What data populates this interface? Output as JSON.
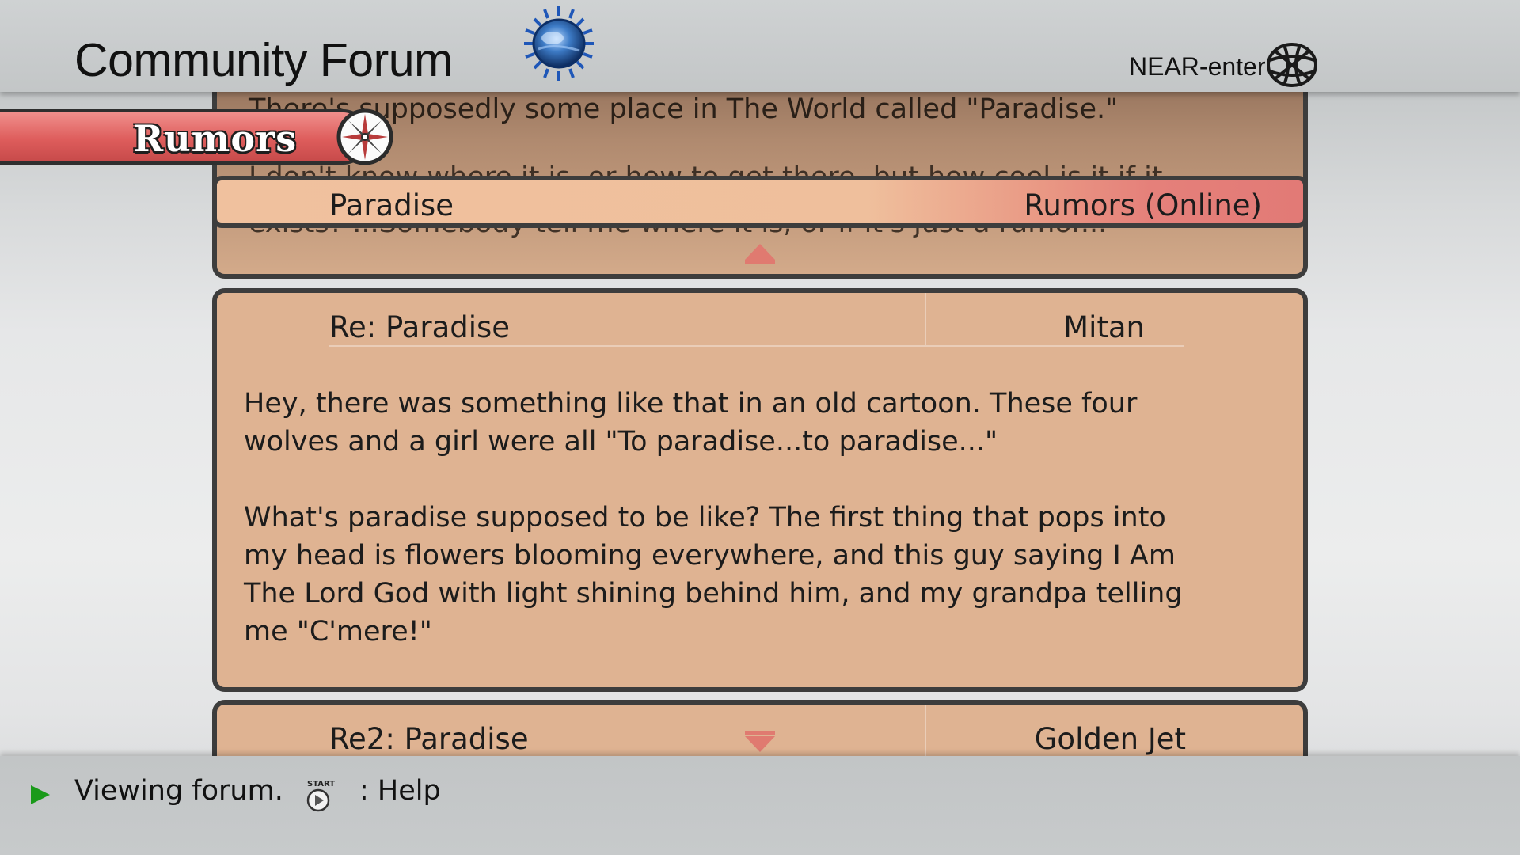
{
  "header": {
    "title": "Community Forum",
    "mode_label": "NEAR-enter",
    "emblem_icon": "world-globe-emblem",
    "network_icon": "globe-wireframe-icon"
  },
  "category": {
    "label": "Rumors",
    "icon": "compass-icon",
    "color": "#de5d5c"
  },
  "previous_post": {
    "line1": "There's supposedly some place in The World called \"Paradise.\"",
    "line2": "I don't know where it is, or how to get there, but how cool is it if it",
    "line3": "exists? ...Somebody tell me where it is, or if it's just a rumor..."
  },
  "topic": {
    "title": "Paradise",
    "board": "Rumors (Online)"
  },
  "current_post": {
    "title": "Re: Paradise",
    "author": "Mitan",
    "paragraphs": [
      "Hey, there was something like that in an old cartoon. These four\nwolves and a girl were all \"To paradise...to paradise...\"",
      "What's paradise supposed to be like? The first thing that pops into\nmy head is flowers blooming everywhere, and this guy saying I Am\nThe Lord God with light shining behind him, and my grandpa telling\nme \"C'mere!\""
    ]
  },
  "next_post": {
    "title": "Re2: Paradise",
    "author": "Golden Jet"
  },
  "footer": {
    "status": "Viewing forum.",
    "start_label": "START",
    "help": ": Help"
  },
  "colors": {
    "panel": "#dfb392",
    "border": "#3d3d3d",
    "accent_red": "#de5d5c",
    "status_arrow": "#1a9a1a"
  }
}
